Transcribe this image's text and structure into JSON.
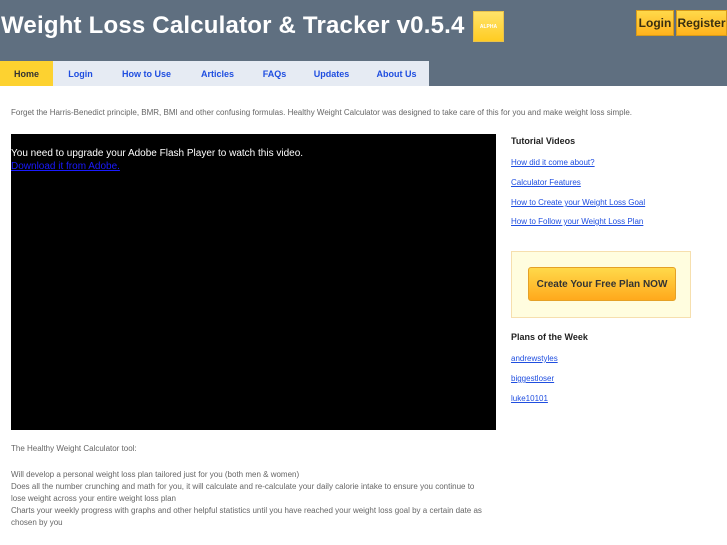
{
  "header": {
    "title": "Weight Loss Calculator & Tracker v0.5.4",
    "badge": "ALPHA",
    "login_label": "Login",
    "register_label": "Register"
  },
  "nav": {
    "items": [
      {
        "label": "Home",
        "active": true
      },
      {
        "label": "Login"
      },
      {
        "label": "How to Use"
      },
      {
        "label": "Articles"
      },
      {
        "label": "FAQs"
      },
      {
        "label": "Updates"
      },
      {
        "label": "About Us"
      }
    ]
  },
  "intro": "Forget the Harris-Benedict principle, BMR, BMI and other confusing formulas. Healthy Weight Calculator was designed to take care of this for you and make weight loss simple.",
  "video": {
    "message": "You need to upgrade your Adobe Flash Player to watch this video.",
    "link": "Download it from Adobe."
  },
  "sidebar": {
    "tutorials_heading": "Tutorial Videos",
    "tutorials": [
      "How did it come about?",
      "Calculator Features",
      "How to Create your Weight Loss Goal",
      "How to Follow your Weight Loss Plan"
    ],
    "cta_label": "Create Your Free Plan NOW",
    "plans_heading": "Plans of the Week",
    "plans": [
      "andrewstyles",
      "biggestloser",
      "luke10101"
    ]
  },
  "body": {
    "tool_heading": "The Healthy Weight Calculator tool:",
    "lines": [
      "Will develop a personal weight loss plan tailored just for you (both men & women)",
      "Does all the number crunching and math for you, it will calculate and re-calculate your daily calorie intake to ensure you continue to",
      "lose weight across your entire weight loss plan",
      "Charts your weekly progress with graphs and other helpful statistics until you have reached your weight loss goal by a certain date as",
      "chosen by you"
    ]
  },
  "colors": {
    "header_bg": "#5f6f80",
    "accent_yellow": "#fdd230",
    "link_blue": "#1f4ee0",
    "nav_bg": "#e6ebf3"
  }
}
